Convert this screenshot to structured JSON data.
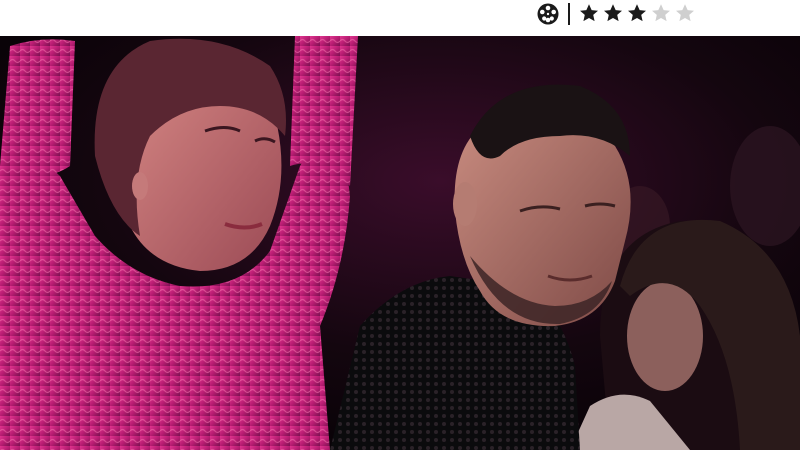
{
  "header": {
    "film_icon": "film-reel-icon",
    "rating": {
      "value": 3,
      "max": 5
    },
    "colors": {
      "star_filled": "#1a1a1a",
      "star_empty": "#cfcfcf",
      "icon": "#1a1a1a"
    }
  },
  "photo": {
    "description_icon": "movie-still-image",
    "colors": {
      "pink_top": "#c2217a",
      "mesh_black": "#0c0c0e",
      "background": "#10050c"
    }
  }
}
